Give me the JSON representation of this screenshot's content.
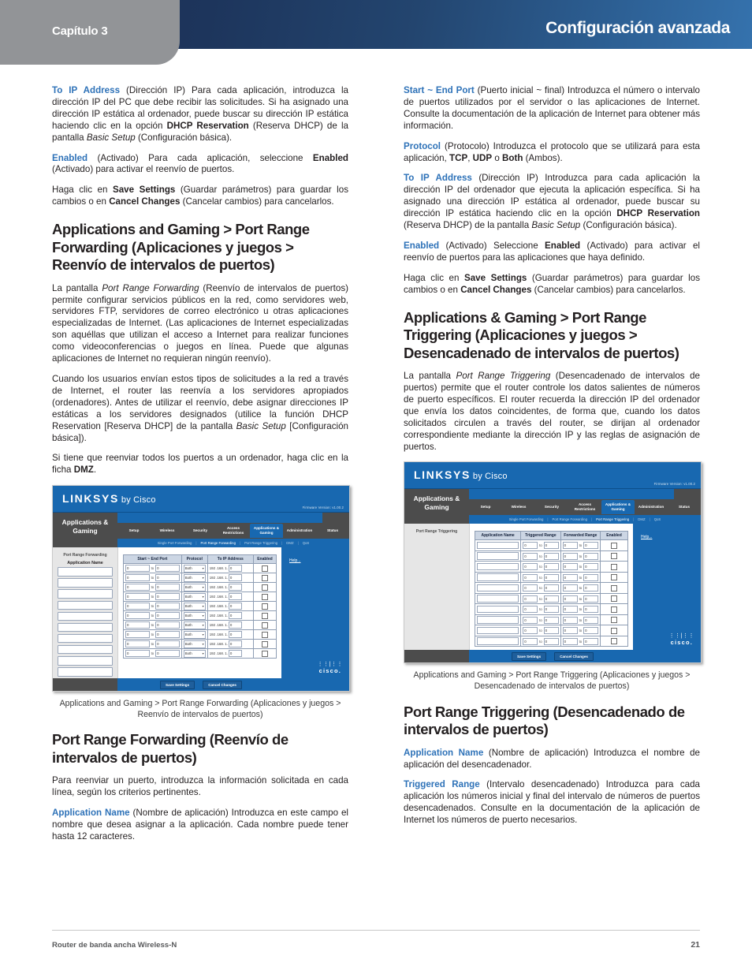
{
  "header": {
    "chapter": "Capítulo 3",
    "title": "Configuración avanzada"
  },
  "footer": {
    "product": "Router de banda ancha Wireless-N",
    "page_number": "21"
  },
  "colors": {
    "term_blue": "#2e72b8",
    "header_blue_dark": "#1b3053",
    "header_blue_light": "#3572ad",
    "chapter_gray": "#929497",
    "router_blue": "#1868b0",
    "router_gray": "#4c4c4c"
  },
  "left_column": {
    "p1": {
      "term": "To IP Address",
      "body_a": " (Dirección IP) Para cada aplicación, introduzca la dirección IP del PC que debe recibir las solicitudes. Si ha asignado una dirección IP estática al ordenador, puede buscar su dirección IP estática haciendo clic en la opción ",
      "bold_a": "DHCP Reservation",
      "body_b": " (Reserva DHCP) de la pantalla ",
      "italic_a": "Basic Setup",
      "body_c": " (Configuración básica)."
    },
    "p2": {
      "term": "Enabled",
      "body_a": " (Activado) Para cada aplicación, seleccione ",
      "bold_a": "Enabled",
      "body_b": " (Activado) para activar el reenvío de puertos."
    },
    "p3": {
      "body_a": "Haga clic en ",
      "bold_a": "Save Settings",
      "body_b": " (Guardar parámetros) para guardar los cambios o en ",
      "bold_b": "Cancel Changes",
      "body_c": " (Cancelar cambios) para cancelarlos."
    },
    "heading1": "Applications and Gaming > Port Range Forwarding (Aplicaciones y juegos > Reenvío de intervalos de puertos)",
    "p4": {
      "body_a": "La pantalla ",
      "italic_a": "Port Range Forwarding",
      "body_b": " (Reenvío de intervalos de puertos) permite configurar servicios públicos en la red, como servidores web, servidores FTP, servidores de correo electrónico u otras aplicaciones especializadas de Internet. (Las aplicaciones de Internet especializadas son aquéllas que utilizan el acceso a Internet para realizar funciones como videoconferencias o juegos en línea. Puede que algunas aplicaciones de Internet no requieran ningún reenvío)."
    },
    "p5": {
      "body_a": "Cuando los usuarios envían estos tipos de solicitudes a la red a través de Internet, el router las reenvía a los servidores apropiados (ordenadores). Antes de utilizar el reenvío, debe asignar direcciones IP estáticas a los servidores designados (utilice la función DHCP Reservation [Reserva DHCP] de la pantalla ",
      "italic_a": "Basic Setup",
      "body_b": " [Configuración básica])."
    },
    "p6": {
      "body_a": "Si tiene que reenviar todos los puertos a un ordenador, haga clic en la ficha ",
      "bold_a": "DMZ",
      "body_b": "."
    },
    "figure_caption": "Applications and Gaming > Port Range Forwarding (Aplicaciones y juegos > Reenvío de intervalos de puertos)",
    "heading2": "Port Range Forwarding (Reenvío de intervalos de puertos)",
    "p7": {
      "body_a": "Para reenviar un puerto, introduzca la información solicitada en cada línea, según los criterios pertinentes."
    },
    "p8": {
      "term": "Application Name",
      "body_a": " (Nombre de aplicación) Introduzca en este campo el nombre que desea asignar a la aplicación. Cada nombre puede tener hasta 12 caracteres."
    }
  },
  "right_column": {
    "p1": {
      "term": "Start ~ End Port",
      "body_a": " (Puerto inicial ~ final) Introduzca el número o intervalo de puertos utilizados por el servidor o las aplicaciones de Internet. Consulte la documentación de la aplicación de Internet para obtener más información."
    },
    "p2": {
      "term": "Protocol",
      "body_a": " (Protocolo) Introduzca el protocolo que se utilizará para esta aplicación, ",
      "bold_a": "TCP",
      "body_b": ", ",
      "bold_b": "UDP",
      "body_c": " o ",
      "bold_c": "Both",
      "body_d": " (Ambos)."
    },
    "p3": {
      "term": "To IP Address",
      "body_a": " (Dirección IP) Introduzca para cada aplicación la dirección IP del ordenador que ejecuta la aplicación específica. Si ha asignado una dirección IP estática al ordenador, puede buscar su dirección IP estática haciendo clic en la opción ",
      "bold_a": "DHCP Reservation",
      "body_b": " (Reserva DHCP) de la pantalla ",
      "italic_a": "Basic Setup",
      "body_c": " (Configuración básica)."
    },
    "p4": {
      "term": "Enabled",
      "body_a": " (Activado) Seleccione ",
      "bold_a": "Enabled",
      "body_b": " (Activado) para activar el reenvío de puertos para las aplicaciones que haya definido."
    },
    "p5": {
      "body_a": "Haga clic en ",
      "bold_a": "Save Settings",
      "body_b": " (Guardar parámetros) para guardar los cambios o en ",
      "bold_b": "Cancel Changes",
      "body_c": " (Cancelar cambios) para cancelarlos."
    },
    "heading1": "Applications & Gaming > Port Range Triggering (Aplicaciones y juegos > Desencadenado de intervalos de puertos)",
    "p6": {
      "body_a": "La pantalla ",
      "italic_a": "Port Range Triggering",
      "body_b": " (Desencadenado de intervalos de puertos) permite que el router controle los datos salientes de números de puerto específicos. El router recuerda la dirección IP del ordenador que envía los datos coincidentes, de forma que, cuando los datos solicitados circulen a través del router, se dirijan al ordenador correspondiente mediante la dirección IP y las reglas de asignación de puertos."
    },
    "figure_caption": "Applications and Gaming > Port Range Triggering (Aplicaciones y juegos > Desencadenado de intervalos de puertos)",
    "heading2": "Port Range Triggering (Desencadenado de intervalos de puertos)",
    "p7": {
      "term": "Application Name",
      "body_a": " (Nombre de aplicación) Introduzca el nombre de aplicación del desencadenador."
    },
    "p8": {
      "term": "Triggered Range",
      "body_a": " (Intervalo desencadenado) Introduzca para cada aplicación los números inicial y final del intervalo de números de puertos desencadenados. Consulte en la documentación de la aplicación de Internet los números de puerto necesarios."
    }
  },
  "router_ui_forwarding": {
    "brand": "LINKSYS",
    "brand_suffix": "by Cisco",
    "firmware": "Firmware Version: v1.00.2",
    "app_title": "Applications & Gaming",
    "tabs": [
      "Setup",
      "Wireless",
      "Security",
      "Access Restrictions",
      "Applications & Gaming",
      "Administration",
      "Status"
    ],
    "active_tab": "Applications & Gaming",
    "subtabs": [
      "Single Port Forwarding",
      "Port Range Forwarding",
      "Port Range Triggering",
      "DMZ",
      "QoS"
    ],
    "active_subtab": "Port Range Forwarding",
    "side_title": "Port Range Forwarding",
    "side_sub": "Application Name",
    "help_label": "Help...",
    "columns": [
      "Start ~ End Port",
      "Protocol",
      "To IP Address",
      "Enabled"
    ],
    "row_count": 10,
    "default_port": "0",
    "to_label": "to",
    "default_protocol": "Both",
    "ip_prefix": "192 .168. 1.",
    "ip_host": "0",
    "save_label": "Save Settings",
    "cancel_label": "Cancel Changes",
    "cisco_word": "cisco."
  },
  "router_ui_triggering": {
    "brand": "LINKSYS",
    "brand_suffix": "by Cisco",
    "firmware": "Firmware Version: v1.00.2",
    "app_title": "Applications & Gaming",
    "tabs": [
      "Setup",
      "Wireless",
      "Security",
      "Access Restrictions",
      "Applications & Gaming",
      "Administration",
      "Status"
    ],
    "active_tab": "Applications & Gaming",
    "subtabs": [
      "Single Port Forwarding",
      "Port Range Forwarding",
      "Port Range Triggering",
      "DMZ",
      "QoS"
    ],
    "active_subtab": "Port Range Triggering",
    "side_title": "Port Range Triggering",
    "help_label": "Help...",
    "columns": [
      "Application Name",
      "Triggered Range",
      "Forwarded Range",
      "Enabled"
    ],
    "row_count": 10,
    "default_port": "0",
    "to_label": "to",
    "save_label": "Save Settings",
    "cancel_label": "Cancel Changes",
    "cisco_word": "cisco."
  }
}
